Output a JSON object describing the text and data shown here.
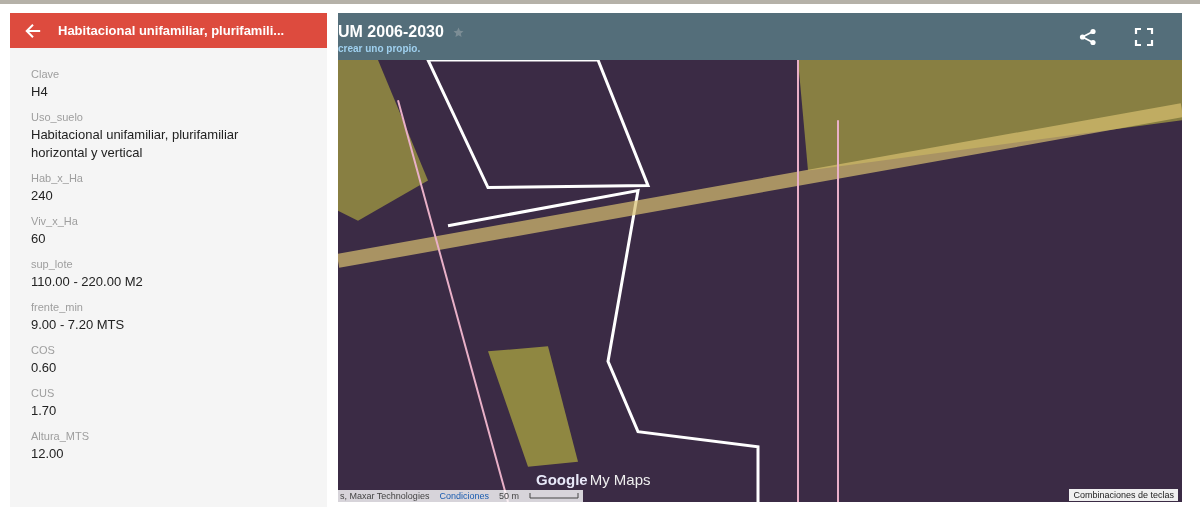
{
  "panel": {
    "title": "Habitacional unifamiliar, plurifamili...",
    "fields": [
      {
        "label": "Clave",
        "value": "H4"
      },
      {
        "label": "Uso_suelo",
        "value": "Habitacional unifamiliar, plurifamiliar horizontal y vertical"
      },
      {
        "label": "Hab_x_Ha",
        "value": "240"
      },
      {
        "label": "Viv_x_Ha",
        "value": "60"
      },
      {
        "label": "sup_lote",
        "value": "110.00 - 220.00 M2"
      },
      {
        "label": "frente_min",
        "value": "9.00 - 7.20 MTS"
      },
      {
        "label": "COS",
        "value": "0.60"
      },
      {
        "label": "CUS",
        "value": "1.70"
      },
      {
        "label": "Altura_MTS",
        "value": "12.00"
      }
    ]
  },
  "map": {
    "title": "UM 2006-2030",
    "subtitle": "crear uno propio.",
    "logo": {
      "brand": "Google",
      "product": "My Maps"
    },
    "attribution": "s, Maxar Technologies",
    "terms_link": "Condiciones",
    "scale": "50 m",
    "shortcuts": "Combinaciones de teclas"
  }
}
